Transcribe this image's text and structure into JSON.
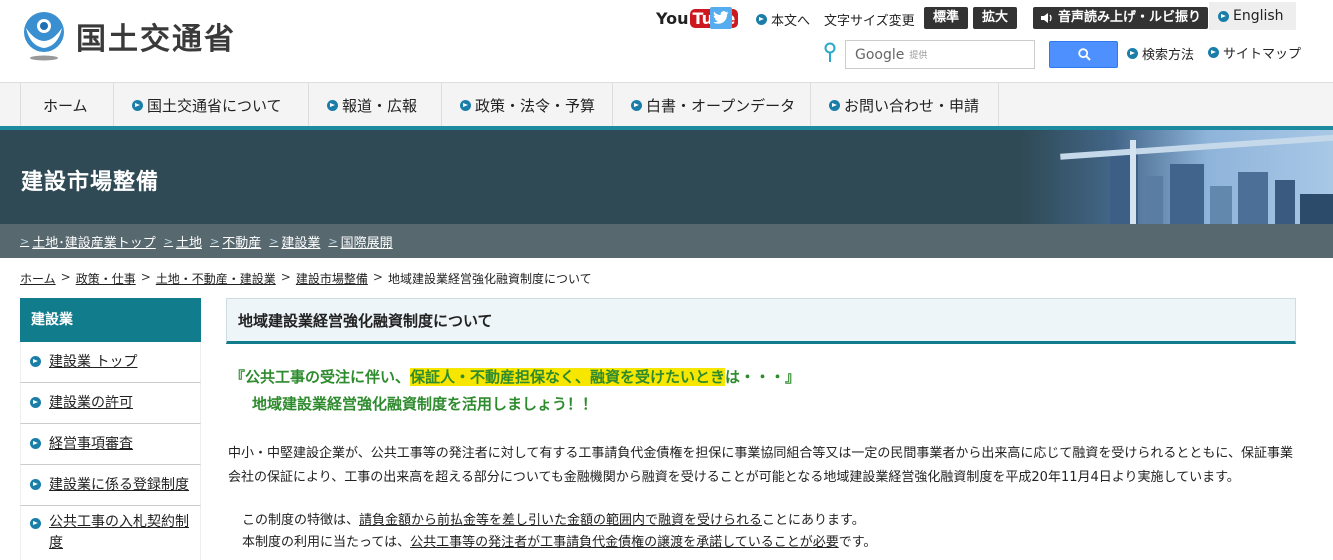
{
  "header": {
    "logo_text": "国土交通省",
    "youtube": {
      "you": "You",
      "tube": "Tube"
    },
    "twitter_icon": "twitter-icon",
    "skip_link": "本文へ",
    "font_size_label": "文字サイズ変更",
    "font_size_standard": "標準",
    "font_size_large": "拡大",
    "tts": "音声読み上げ・ルビ振り",
    "english": "English",
    "search": {
      "brand": "Google",
      "provided": "提供",
      "placeholder": ""
    },
    "search_method": "検索方法",
    "sitemap": "サイトマップ"
  },
  "nav": {
    "items": [
      {
        "label": "ホーム"
      },
      {
        "label": "国土交通省について"
      },
      {
        "label": "報道・広報"
      },
      {
        "label": "政策・法令・予算"
      },
      {
        "label": "白書・オープンデータ"
      },
      {
        "label": "お問い合わせ・申請"
      }
    ]
  },
  "banner": {
    "title": "建設市場整備"
  },
  "subnav": {
    "items": [
      {
        "label": "土地･建設産業トップ"
      },
      {
        "label": "土地"
      },
      {
        "label": "不動産"
      },
      {
        "label": "建設業"
      },
      {
        "label": "国際展開"
      }
    ]
  },
  "breadcrumb": {
    "items": [
      "ホーム",
      "政策・仕事",
      "土地・不動産・建設業",
      "建設市場整備"
    ],
    "current": "地域建設業経営強化融資制度について"
  },
  "sidebar": {
    "heading": "建設業",
    "items": [
      {
        "label": "建設業 トップ"
      },
      {
        "label": "建設業の許可"
      },
      {
        "label": "経営事項審査"
      },
      {
        "label": "建設業に係る登録制度"
      },
      {
        "label": "公共工事の入札契約制度"
      }
    ]
  },
  "main": {
    "page_title": "地域建設業経営強化融資制度について",
    "lead1_pre": "『公共工事の受注に伴い、",
    "lead1_highlight": "保証人・不動産担保なく、融資を受けたいとき",
    "lead1_post": "は・・・』",
    "lead2": "地域建設業経営強化融資制度を活用しましょう！！",
    "paragraph": "中小・中堅建設企業が、公共工事等の発注者に対して有する工事請負代金債権を担保に事業協同組合等又は一定の民間事業者から出来高に応じて融資を受けられるとともに、保証事業会社の保証により、工事の出来高を超える部分についても金融機関から融資を受けることが可能となる地域建設業経営強化融資制度を平成20年11月4日より実施しています。",
    "feature_pre": "この制度の特徴は、",
    "feature_u": "請負金額から前払金等を差し引いた金額の範囲内で融資を受けられる",
    "feature_post": "ことにあります。",
    "usage_pre": "本制度の利用に当たっては、",
    "usage_u": "公共工事等の発注者が工事請負代金債権の譲渡を承諾していることが必要",
    "usage_post": "です。"
  },
  "colors": {
    "accent": "#117c8c",
    "banner_bg": "#2f4a55",
    "subnav_bg": "#58686f",
    "lead_green": "#2e8b2e",
    "highlight": "#f7e600"
  }
}
